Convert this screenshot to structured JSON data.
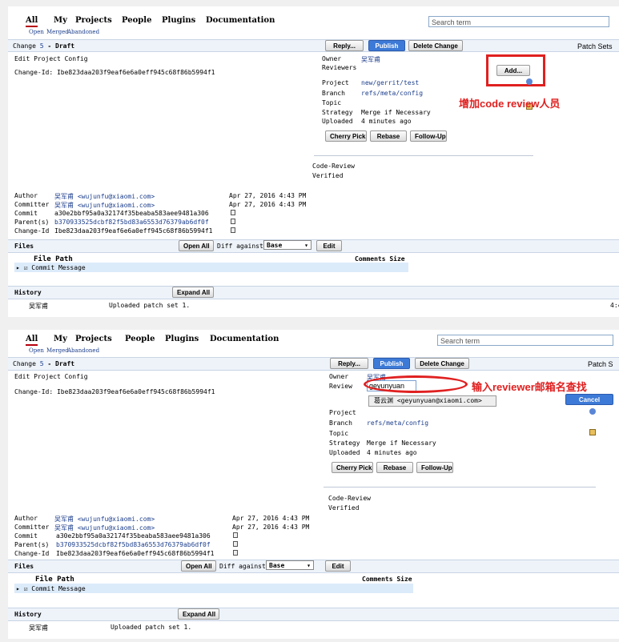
{
  "nav": {
    "tabs": [
      "All",
      "My",
      "Projects",
      "People",
      "Plugins",
      "Documentation"
    ],
    "subtabs": [
      "Open",
      "Merged",
      "Abandoned"
    ],
    "search_placeholder": "Search term"
  },
  "change": {
    "label": "Change",
    "number": "5",
    "status": "- Draft",
    "subject": "Edit Project Config",
    "change_id_line": "Change-Id: Ibe823daa203f9eaf6e6a0eff945c68f86b5994f1"
  },
  "actions": {
    "reply": "Reply...",
    "publish": "Publish",
    "delete": "Delete Change",
    "patch_sets": "Patch Sets",
    "patch_sets_cut": "Patch S",
    "cherry_pick": "Cherry Pick",
    "rebase": "Rebase",
    "follow_up": "Follow-Up",
    "add": "Add...",
    "cancel": "Cancel"
  },
  "info": {
    "owner_label": "Owner",
    "owner": "吴军甫",
    "reviewers_label": "Reviewers",
    "reviewers_label_cut": "Review",
    "project_label": "Project",
    "project": "new/gerrit/test",
    "branch_label": "Branch",
    "branch": "refs/meta/config",
    "topic_label": "Topic",
    "strategy_label": "Strategy",
    "strategy": "Merge if Necessary",
    "uploaded_label": "Uploaded",
    "uploaded": "4 minutes ago"
  },
  "labels": {
    "code_review": "Code-Review",
    "verified": "Verified"
  },
  "commit": {
    "author_label": "Author",
    "author": "吴军甫 <wujunfu@xiaomi.com>",
    "author_date": "Apr 27, 2016 4:43 PM",
    "committer_label": "Committer",
    "committer": "吴军甫 <wujunfu@xiaomi.com>",
    "committer_date": "Apr 27, 2016 4:43 PM",
    "commit_label": "Commit",
    "commit": "a30e2bbf95a0a32174f35beaba583aee9481a306",
    "parents_label": "Parent(s)",
    "parents": "b370933525dcbf82f5bd83a6553d76379ab6df0f",
    "changeid_label": "Change-Id",
    "changeid": "Ibe823daa203f9eaf6e6a0eff945c68f86b5994f1"
  },
  "files": {
    "title": "Files",
    "open_all": "Open All",
    "diff_against_label": "Diff against:",
    "diff_against_value": "Base",
    "edit": "Edit",
    "file_path_header": "File Path",
    "comments_size_header": "Comments Size",
    "rows": [
      "Commit Message"
    ]
  },
  "history": {
    "title": "History",
    "expand_all": "Expand All",
    "author": "吴军甫",
    "message": "Uploaded patch set 1.",
    "time_cut": "4:4"
  },
  "annotations": {
    "add_reviewer": "增加code review人员",
    "search_by_email": "输入reviewer邮箱名查找"
  },
  "reviewer_search": {
    "input_value": "geyunyuan",
    "suggestion": "葛云渊 <geyunyuan@xiaomi.com>"
  },
  "colors": {
    "accent_red": "#e02020",
    "publish_blue": "#3d7ad7",
    "link_blue": "#1c3e8c"
  }
}
